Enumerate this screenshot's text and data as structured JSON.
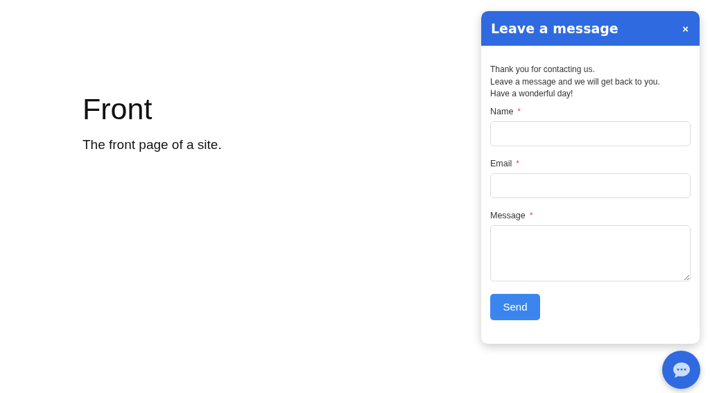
{
  "page": {
    "title": "Front",
    "subtitle": "The front page of a site."
  },
  "chat_panel": {
    "title": "Leave a message",
    "close": "×",
    "intro": [
      "Thank you for contacting us.",
      "Leave a message and we will get back to you.",
      "Have a wonderful day!"
    ],
    "fields": [
      {
        "kind": "input",
        "label": "Name",
        "required_mark": "*"
      },
      {
        "kind": "input",
        "label": "Email",
        "required_mark": "*"
      },
      {
        "kind": "textarea",
        "label": "Message",
        "required_mark": "*"
      }
    ],
    "submit": "Send"
  }
}
